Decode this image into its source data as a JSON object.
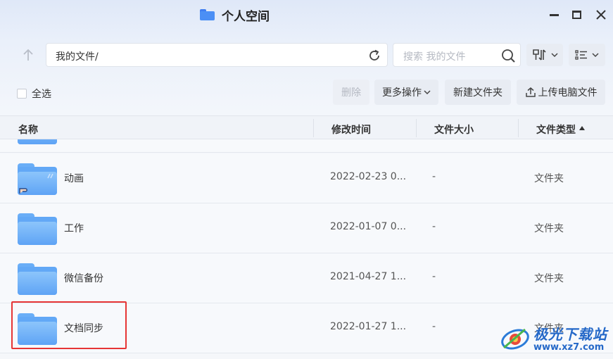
{
  "window": {
    "title": "个人空间"
  },
  "address": {
    "path": "我的文件/",
    "search_placeholder": "搜索 我的文件"
  },
  "actions": {
    "select_all": "全选",
    "delete": "删除",
    "more": "更多操作",
    "new_folder": "新建文件夹",
    "upload": "上传电脑文件"
  },
  "table": {
    "headers": {
      "name": "名称",
      "modified": "修改时间",
      "size": "文件大小",
      "type": "文件类型"
    },
    "sort_column": "type",
    "sort_direction": "asc",
    "rows": [
      {
        "name": "动画",
        "modified": "2022-02-23 0...",
        "size": "-",
        "type": "文件夹"
      },
      {
        "name": "工作",
        "modified": "2022-01-07 0...",
        "size": "-",
        "type": "文件夹"
      },
      {
        "name": "微信备份",
        "modified": "2021-04-27 1...",
        "size": "-",
        "type": "文件夹"
      },
      {
        "name": "文档同步",
        "modified": "2022-01-27 1...",
        "size": "-",
        "type": "文件夹"
      }
    ]
  },
  "watermark": {
    "name": "极光下载站",
    "url": "www.xz7.com"
  },
  "colors": {
    "accent": "#4b8ff5",
    "highlight": "#e63535",
    "folder": "#62a8f6"
  }
}
